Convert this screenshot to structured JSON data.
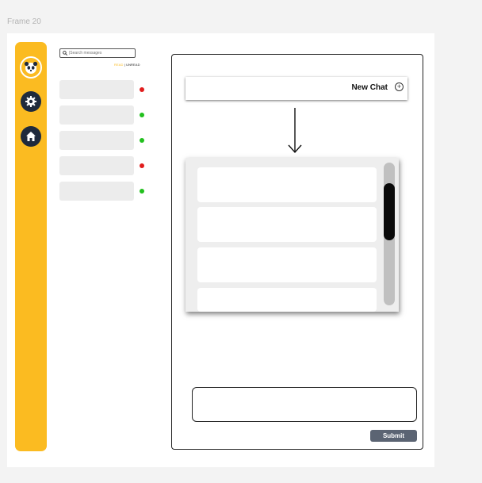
{
  "frame": {
    "label": "Frame 20"
  },
  "search": {
    "placeholder": "|Search messages"
  },
  "filters": {
    "read": "READ",
    "separator": " | ",
    "unread": "UNREAD"
  },
  "messages": [
    {
      "status": "unread",
      "dot_color": "#e11d1d"
    },
    {
      "status": "online",
      "dot_color": "#22c01e"
    },
    {
      "status": "online",
      "dot_color": "#22c01e"
    },
    {
      "status": "unread",
      "dot_color": "#e11d1d"
    },
    {
      "status": "online",
      "dot_color": "#22c01e"
    }
  ],
  "new_chat": {
    "label": "New Chat",
    "icon": "plus-circle-icon"
  },
  "chat_list": {
    "rows": 4
  },
  "submit": {
    "label": "Submit"
  },
  "colors": {
    "accent": "#fbbb21",
    "sidebar_icon_bg": "#1f2a3c",
    "submit_bg": "#5b6473"
  }
}
